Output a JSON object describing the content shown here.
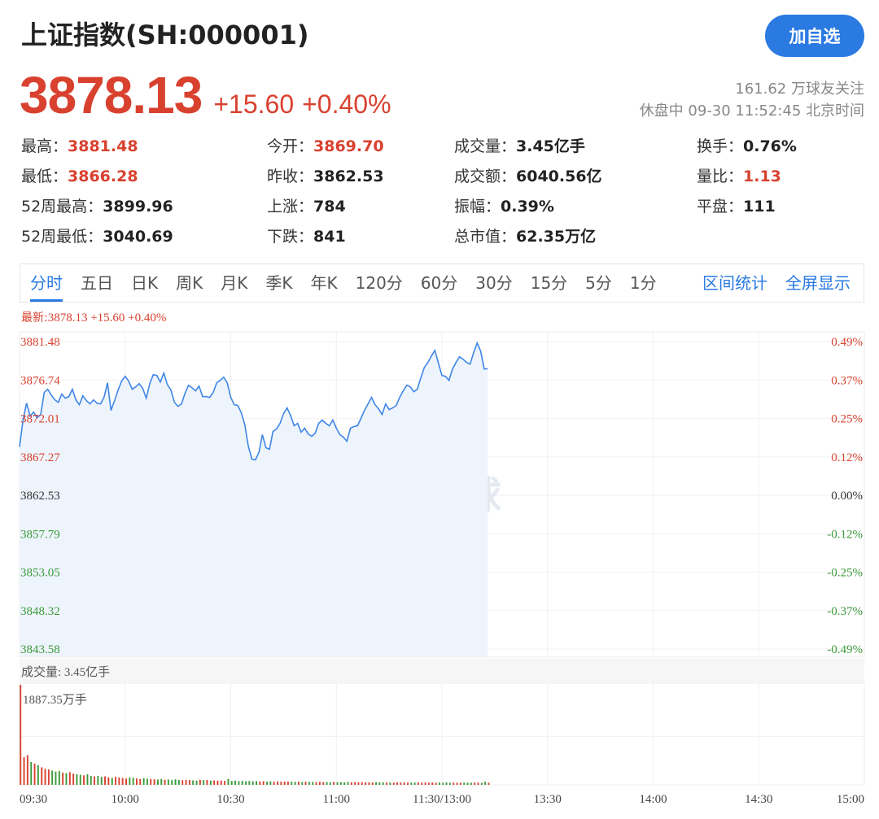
{
  "header": {
    "title": "上证指数(SH:000001)",
    "follow_label": "加自选"
  },
  "quote": {
    "price": "3878.13",
    "change": "+15.60",
    "change_pct": "+0.40%",
    "followers": "161.62 万球友关注",
    "status_time": "休盘中 09-30 11:52:45 北京时间"
  },
  "stats": [
    {
      "label": "最高：",
      "value": "3881.48",
      "red": true
    },
    {
      "label": "今开：",
      "value": "3869.70",
      "red": true
    },
    {
      "label": "成交量：",
      "value": "3.45亿手",
      "red": false
    },
    {
      "label": "换手：",
      "value": "0.76%",
      "red": false
    },
    {
      "label": "最低：",
      "value": "3866.28",
      "red": true
    },
    {
      "label": "昨收：",
      "value": "3862.53",
      "red": false
    },
    {
      "label": "成交额：",
      "value": "6040.56亿",
      "red": false
    },
    {
      "label": "量比：",
      "value": "1.13",
      "red": true
    },
    {
      "label": "52周最高：",
      "value": "3899.96",
      "red": false
    },
    {
      "label": "上涨：",
      "value": "784",
      "red": false
    },
    {
      "label": "振幅：",
      "value": "0.39%",
      "red": false
    },
    {
      "label": "平盘：",
      "value": "111",
      "red": false
    },
    {
      "label": "52周最低：",
      "value": "3040.69",
      "red": false
    },
    {
      "label": "下跌：",
      "value": "841",
      "red": false
    },
    {
      "label": "总市值：",
      "value": "62.35万亿",
      "red": false
    }
  ],
  "tabs": [
    "分时",
    "五日",
    "日K",
    "周K",
    "月K",
    "季K",
    "年K",
    "120分",
    "60分",
    "30分",
    "15分",
    "5分",
    "1分"
  ],
  "tab_right": [
    "区间统计",
    "全屏显示"
  ],
  "latest": {
    "label": "最新:",
    "value": "3878.13 +15.60 +0.40%"
  },
  "watermark": "雪球",
  "colors": {
    "up": "#d9412f",
    "down": "#3a9a3a",
    "line": "#3f86e6",
    "accent": "#2a7ae2"
  },
  "chart_data": {
    "type": "line",
    "price_ticks": [
      "3881.48",
      "3876.74",
      "3872.01",
      "3867.27",
      "3862.53",
      "3857.79",
      "3853.05",
      "3848.32",
      "3843.58"
    ],
    "pct_ticks": [
      "0.49%",
      "0.37%",
      "0.25%",
      "0.12%",
      "0.00%",
      "-0.12%",
      "-0.25%",
      "-0.37%",
      "-0.49%"
    ],
    "ylim": [
      3843.58,
      3881.48
    ],
    "x_ticks": [
      "09:30",
      "10:00",
      "10:30",
      "11:00",
      "11:30/13:00",
      "13:30",
      "14:00",
      "14:30",
      "15:00"
    ],
    "volume_label": "成交量: 3.45亿手",
    "volume_max_label": "1887.35万手",
    "volume_max": 1887.35,
    "price_series": [
      3868.5,
      3871.8,
      3873.9,
      3872.3,
      3872.8,
      3872.1,
      3872.5,
      3875.2,
      3875.6,
      3874.9,
      3874.3,
      3874.0,
      3875.0,
      3874.5,
      3874.7,
      3875.6,
      3874.3,
      3873.7,
      3874.8,
      3874.2,
      3873.8,
      3874.3,
      3873.9,
      3873.8,
      3874.6,
      3876.4,
      3873.0,
      3874.2,
      3875.5,
      3876.6,
      3877.2,
      3876.6,
      3875.6,
      3875.9,
      3876.3,
      3875.7,
      3874.5,
      3876.3,
      3877.4,
      3877.3,
      3876.5,
      3877.6,
      3876.2,
      3875.5,
      3874.0,
      3873.5,
      3873.8,
      3875.1,
      3876.1,
      3875.8,
      3875.4,
      3876.0,
      3874.7,
      3874.7,
      3874.6,
      3875.2,
      3876.4,
      3876.7,
      3877.1,
      3876.4,
      3874.6,
      3873.7,
      3873.6,
      3872.7,
      3871.2,
      3868.6,
      3867.0,
      3866.9,
      3867.8,
      3870.0,
      3868.4,
      3868.2,
      3870.4,
      3870.7,
      3871.4,
      3872.6,
      3873.3,
      3872.4,
      3871.1,
      3871.4,
      3870.3,
      3870.8,
      3870.1,
      3869.8,
      3870.2,
      3871.4,
      3871.8,
      3871.4,
      3871.1,
      3871.8,
      3870.8,
      3870.0,
      3869.7,
      3869.2,
      3870.8,
      3871.0,
      3871.1,
      3872.0,
      3873.0,
      3873.8,
      3874.6,
      3873.7,
      3873.2,
      3872.5,
      3873.8,
      3873.1,
      3873.3,
      3873.6,
      3874.6,
      3875.4,
      3876.1,
      3875.9,
      3875.3,
      3875.6,
      3877.0,
      3878.3,
      3878.9,
      3879.7,
      3880.4,
      3878.8,
      3877.3,
      3877.2,
      3876.7,
      3878.1,
      3878.9,
      3879.6,
      3879.3,
      3878.9,
      3878.7,
      3880.1,
      3881.3,
      3880.3,
      3878.1,
      3878.13
    ],
    "volume_series": [
      1887.35,
      520,
      560,
      430,
      400,
      370,
      330,
      300,
      290,
      270,
      250,
      260,
      230,
      220,
      240,
      210,
      200,
      190,
      180,
      200,
      170,
      160,
      170,
      150,
      160,
      140,
      130,
      150,
      140,
      130,
      120,
      140,
      130,
      120,
      110,
      125,
      115,
      110,
      105,
      100,
      110,
      95,
      100,
      90,
      105,
      92,
      88,
      95,
      90,
      85,
      80,
      95,
      88,
      92,
      80,
      85,
      78,
      82,
      75,
      110,
      72,
      78,
      70,
      74,
      68,
      72,
      66,
      70,
      64,
      68,
      62,
      66,
      60,
      64,
      58,
      62,
      60,
      58,
      56,
      60,
      54,
      58,
      55,
      56,
      52,
      58,
      50,
      54,
      48,
      56,
      50,
      52,
      48,
      54,
      46,
      52,
      48,
      50,
      46,
      48,
      44,
      50,
      46,
      48,
      44,
      46,
      42,
      48,
      44,
      46,
      42,
      45,
      43,
      44,
      42,
      46,
      41,
      44,
      42,
      43,
      40,
      44,
      41,
      42,
      40,
      43,
      42,
      41,
      40,
      42,
      41,
      40,
      60,
      40
    ]
  }
}
